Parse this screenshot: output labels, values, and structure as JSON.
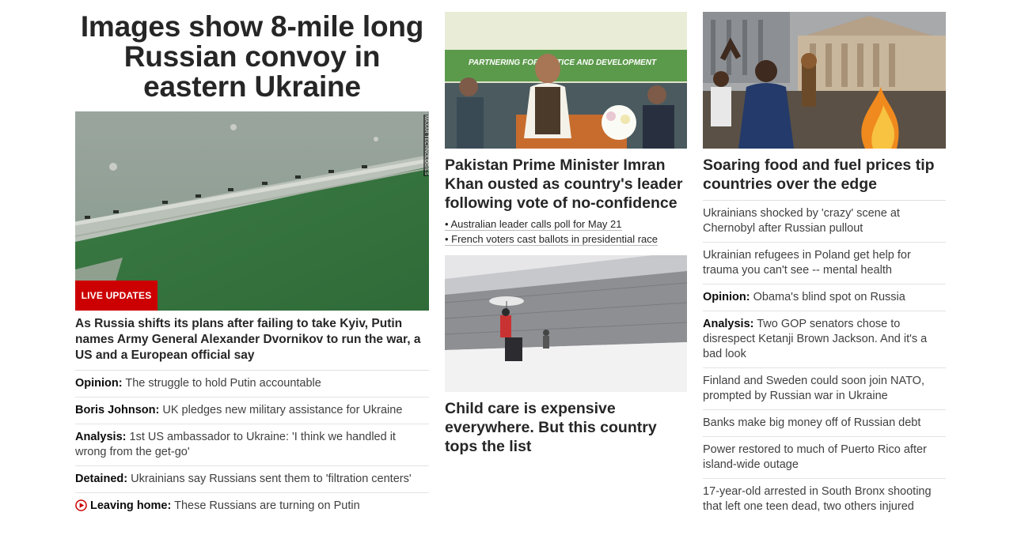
{
  "col1": {
    "headline": "Images show 8-mile long Russian convoy in eastern Ukraine",
    "image_credit": "MAXAR TECHNOLOGIES",
    "badge": "LIVE UPDATES",
    "deck": "As Russia shifts its plans after failing to take Kyiv, Putin names Army General Alexander Dvornikov to run the war, a US and a European official say",
    "items": [
      {
        "prefix": "Opinion:",
        "text": " The struggle to hold Putin accountable"
      },
      {
        "prefix": "Boris Johnson:",
        "text": " UK pledges new military assistance for Ukraine"
      },
      {
        "prefix": "Analysis:",
        "text": " 1st US ambassador to Ukraine: 'I think we handled it wrong from the get-go'"
      },
      {
        "prefix": "Detained:",
        "text": " Ukrainians say Russians sent them to 'filtration centers'"
      },
      {
        "prefix": "Leaving home:",
        "text": " These Russians are turning on Putin",
        "icon": "play-icon"
      }
    ]
  },
  "col2": {
    "story1": {
      "title": "Pakistan Prime Minister Imran Khan ousted as country's leader following vote of no-confidence",
      "bullets": [
        "• Australian leader calls poll for May 21",
        "• French voters cast ballots in presidential race"
      ],
      "banner_text": "PARTNERING FOR JUSTICE AND DEVELOPMENT"
    },
    "story2": {
      "title": "Child care is expensive everywhere. But this country tops the list"
    }
  },
  "col3": {
    "title": "Soaring food and fuel prices tip countries over the edge",
    "items": [
      {
        "prefix": "",
        "text": "Ukrainians shocked by 'crazy' scene at Chernobyl after Russian pullout"
      },
      {
        "prefix": "",
        "text": "Ukrainian refugees in Poland get help for trauma you can't see -- mental health"
      },
      {
        "prefix": "Opinion:",
        "text": " Obama's blind spot on Russia"
      },
      {
        "prefix": "Analysis:",
        "text": " Two GOP senators chose to disrespect Ketanji Brown Jackson. And it's a bad look"
      },
      {
        "prefix": "",
        "text": "Finland and Sweden could soon join NATO, prompted by Russian war in Ukraine"
      },
      {
        "prefix": "",
        "text": "Banks make big money off of Russian debt"
      },
      {
        "prefix": "",
        "text": "Power restored to much of Puerto Rico after island-wide outage"
      },
      {
        "prefix": "",
        "text": "17-year-old arrested in South Bronx shooting that left one teen dead, two others injured"
      }
    ]
  },
  "colors": {
    "live_badge": "#cc0000",
    "play_icon": "#cc0000"
  }
}
